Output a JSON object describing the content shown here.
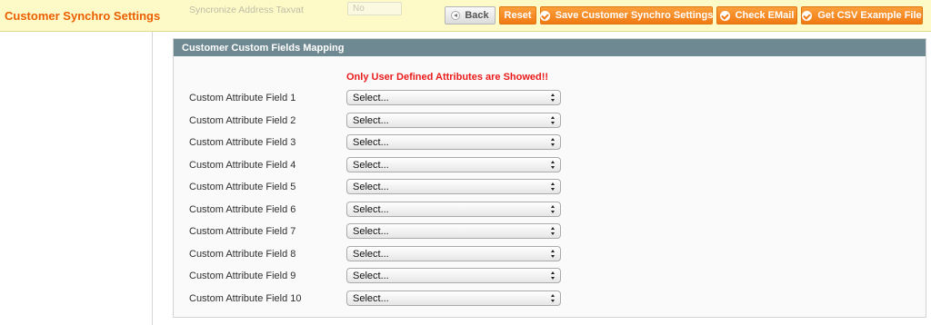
{
  "header": {
    "title": "Customer Synchro Settings",
    "background_color": "#fdfac8",
    "title_color": "#eb5e00",
    "ghost_field": {
      "label": "Syncronize Address Taxvat",
      "value": "No"
    },
    "buttons": {
      "back": "Back",
      "reset": "Reset",
      "save": "Save Customer Synchro Settings",
      "check_email": "Check EMail",
      "csv_example": "Get CSV Example File"
    },
    "button_color": "#f57f16"
  },
  "section": {
    "title": "Customer Custom Fields Mapping",
    "header_color": "#6f8992",
    "notice": "Only User Defined Attributes are Showed!!",
    "notice_color": "#eb1b1b",
    "rows": [
      {
        "label": "Custom Attribute Field 1",
        "value": "Select..."
      },
      {
        "label": "Custom Attribute Field 2",
        "value": "Select..."
      },
      {
        "label": "Custom Attribute Field 3",
        "value": "Select..."
      },
      {
        "label": "Custom Attribute Field 4",
        "value": "Select..."
      },
      {
        "label": "Custom Attribute Field 5",
        "value": "Select..."
      },
      {
        "label": "Custom Attribute Field 6",
        "value": "Select..."
      },
      {
        "label": "Custom Attribute Field 7",
        "value": "Select..."
      },
      {
        "label": "Custom Attribute Field 8",
        "value": "Select..."
      },
      {
        "label": "Custom Attribute Field 9",
        "value": "Select..."
      },
      {
        "label": "Custom Attribute Field 10",
        "value": "Select..."
      }
    ]
  }
}
